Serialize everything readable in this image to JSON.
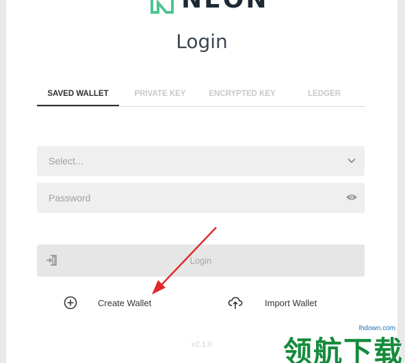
{
  "logo": {
    "text": "NEON"
  },
  "title": "Login",
  "tabs": [
    {
      "label": "SAVED WALLET",
      "active": true
    },
    {
      "label": "PRIVATE KEY",
      "active": false
    },
    {
      "label": "ENCRYPTED KEY",
      "active": false
    },
    {
      "label": "LEDGER",
      "active": false
    }
  ],
  "wallet_select": {
    "placeholder": "Select..."
  },
  "password": {
    "placeholder": "Password"
  },
  "login_button": {
    "label": "Login"
  },
  "actions": {
    "create": {
      "label": "Create Wallet",
      "icon": "plus-circle-icon"
    },
    "import": {
      "label": "Import Wallet",
      "icon": "cloud-upload-icon"
    }
  },
  "version": "v2.1.0",
  "watermark": {
    "url": "lhdown.com",
    "text": "领航下载"
  },
  "colors": {
    "accent": "#4cc48f",
    "arrow": "#e02a2a",
    "watermark": "#168b3c"
  }
}
